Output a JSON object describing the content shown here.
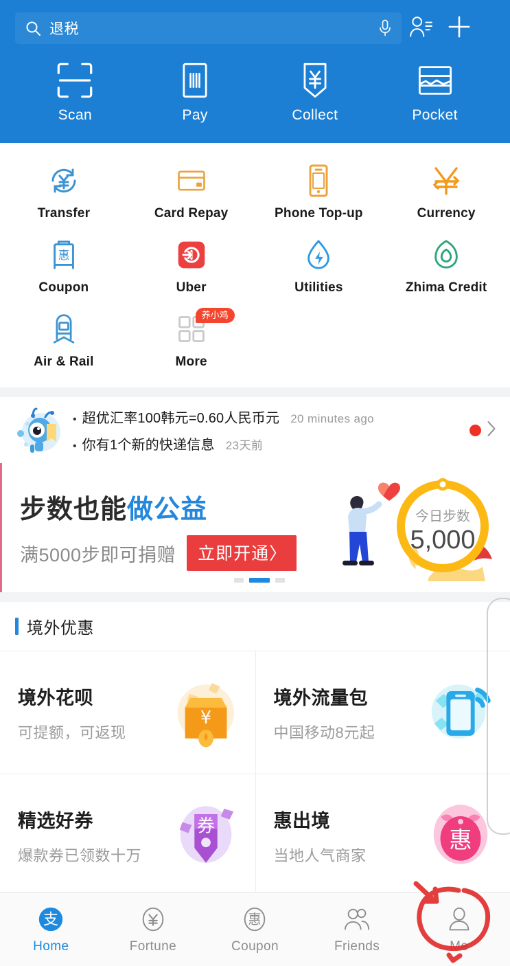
{
  "header": {
    "background_color": "#1d7fd3",
    "search": {
      "value": "退税",
      "placeholder": "退税",
      "icon": "search-icon",
      "mic_icon": "microphone-icon"
    },
    "contacts_icon": "contacts-person-icon",
    "add_icon": "plus-icon",
    "quick_actions": [
      {
        "label": "Scan",
        "icon": "scan-frame-icon"
      },
      {
        "label": "Pay",
        "icon": "barcode-pay-icon"
      },
      {
        "label": "Collect",
        "icon": "collect-money-icon"
      },
      {
        "label": "Pocket",
        "icon": "pocket-wallet-icon"
      }
    ]
  },
  "app_grid": {
    "rows": [
      [
        {
          "label": "Transfer",
          "icon": "transfer-yuan-circle-icon",
          "color": "#3b93d3"
        },
        {
          "label": "Card Repay",
          "icon": "credit-card-icon",
          "color": "#eda33c"
        },
        {
          "label": "Phone Top-up",
          "icon": "mobile-phone-icon",
          "color": "#eda33c"
        },
        {
          "label": "Currency",
          "icon": "currency-exchange-icon",
          "color": "#f29a1d"
        }
      ],
      [
        {
          "label": "Coupon",
          "icon": "coupon-machine-icon",
          "color": "#3b93d3"
        },
        {
          "label": "Uber",
          "icon": "uber-icon",
          "color": "#ec4040"
        },
        {
          "label": "Utilities",
          "icon": "utilities-droplet-bolt-icon",
          "color": "#2f9ae0"
        },
        {
          "label": "Zhima Credit",
          "icon": "zhima-credit-leaf-icon",
          "color": "#2fa57a"
        }
      ],
      [
        {
          "label": "Air & Rail",
          "icon": "train-icon",
          "color": "#3b93d3"
        },
        {
          "label": "More",
          "icon": "more-grid-icon",
          "color": "#c9c9c9",
          "badge": "养小鸡"
        }
      ]
    ]
  },
  "notification": {
    "avatar_icon": "assistant-robot-avatar",
    "items": [
      {
        "text": "超优汇率100韩元=0.60人民币元",
        "time": "20 minutes ago"
      },
      {
        "text": "你有1个新的快递信息",
        "time": "23天前"
      }
    ],
    "unread_dot_color": "#ee3124",
    "chevron_icon": "chevron-right-icon"
  },
  "banner": {
    "title_plain": "步数也能",
    "title_highlight": "做公益",
    "subtitle": "满5000步即可捐赠",
    "cta_label": "立即开通〉",
    "steps_ring_label": "今日步数",
    "steps_value": "5,000",
    "accent_color": "#ea3d3d",
    "ring_color": "#fcb813",
    "carousel": {
      "total": 3,
      "active_index": 1
    }
  },
  "section": {
    "title": "境外优惠",
    "accent_color": "#2487db"
  },
  "cards": [
    [
      {
        "title": "境外花呗",
        "subtitle": "可提额，可返现",
        "icon": "huabei-shop-orange-icon"
      },
      {
        "title": "境外流量包",
        "subtitle": "中国移动8元起",
        "icon": "data-plan-phone-icon"
      }
    ],
    [
      {
        "title": "精选好券",
        "subtitle": "爆款券已领数十万",
        "icon": "coupon-tag-purple-icon"
      },
      {
        "title": "惠出境",
        "subtitle": "当地人气商家",
        "icon": "hui-pink-icon"
      }
    ]
  ],
  "tabbar": {
    "items": [
      {
        "label": "Home",
        "icon": "alipay-zhi-icon",
        "active": true
      },
      {
        "label": "Fortune",
        "icon": "fortune-yuan-icon",
        "active": false
      },
      {
        "label": "Coupon",
        "icon": "coupon-hui-icon",
        "active": false
      },
      {
        "label": "Friends",
        "icon": "friends-people-icon",
        "active": false
      },
      {
        "label": "Me",
        "icon": "me-person-icon",
        "active": false
      }
    ],
    "active_color": "#1d8ae0",
    "inactive_color": "#8d8d8d",
    "annotation": {
      "target": "Me",
      "shape": "red-circle-with-arrow",
      "color": "#e03030"
    }
  }
}
